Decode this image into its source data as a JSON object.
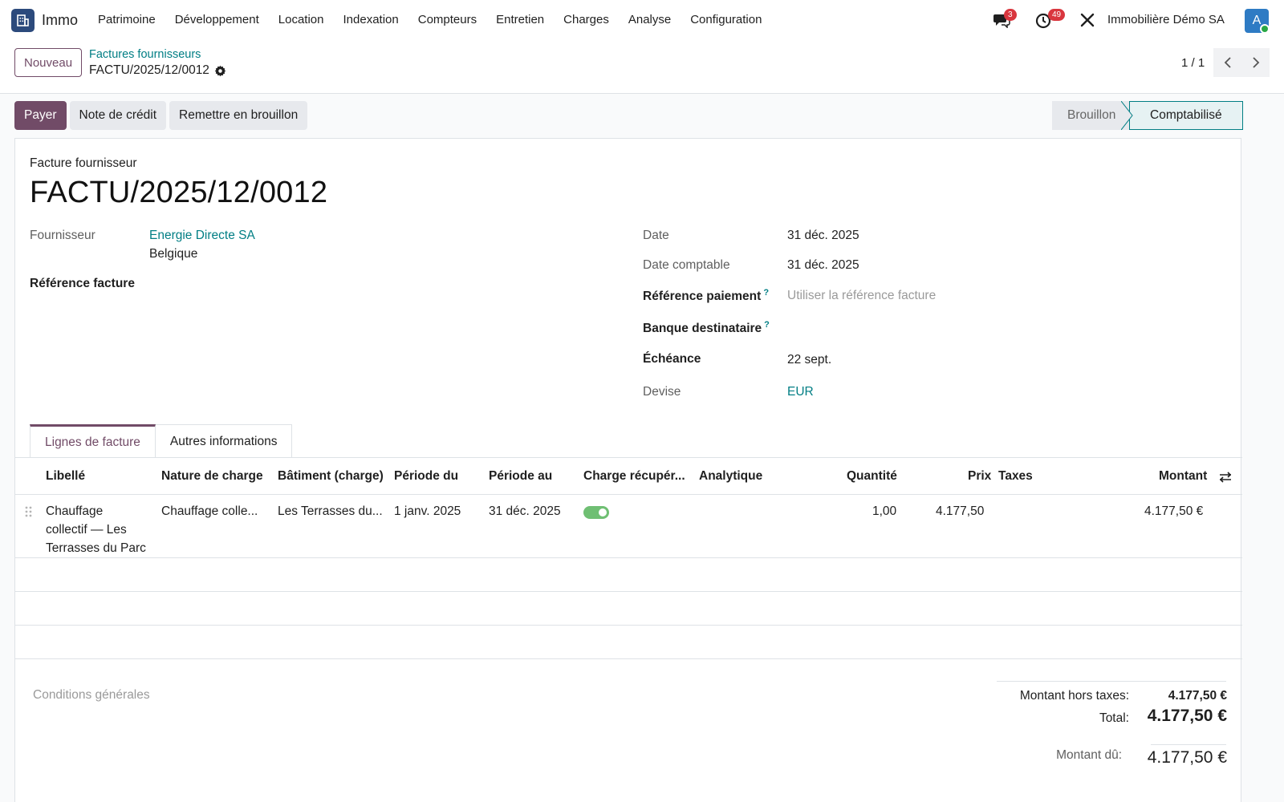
{
  "navbar": {
    "app_name": "Immo",
    "menu": [
      "Patrimoine",
      "Développement",
      "Location",
      "Indexation",
      "Compteurs",
      "Entretien",
      "Charges",
      "Analyse",
      "Configuration"
    ],
    "messages_count": "3",
    "activities_count": "49",
    "company": "Immobilière Démo SA",
    "avatar_letter": "A"
  },
  "control": {
    "new_label": "Nouveau",
    "breadcrumb_parent": "Factures fournisseurs",
    "breadcrumb_current": "FACTU/2025/12/0012",
    "pager": "1 / 1"
  },
  "actions": {
    "pay": "Payer",
    "credit_note": "Note de crédit",
    "reset_draft": "Remettre en brouillon"
  },
  "status": {
    "draft": "Brouillon",
    "posted": "Comptabilisé"
  },
  "form": {
    "doc_type": "Facture fournisseur",
    "title": "FACTU/2025/12/0012",
    "supplier_label": "Fournisseur",
    "supplier_name": "Energie Directe SA",
    "supplier_country": "Belgique",
    "ref_label": "Référence facture",
    "date_label": "Date",
    "date_value": "31 déc. 2025",
    "acc_date_label": "Date comptable",
    "acc_date_value": "31 déc. 2025",
    "pay_ref_label": "Référence paiement",
    "pay_ref_placeholder": "Utiliser la référence facture",
    "bank_label": "Banque destinataire",
    "due_label": "Échéance",
    "due_value": "22 sept.",
    "currency_label": "Devise",
    "currency_value": "EUR",
    "help_mark": "?"
  },
  "tabs": {
    "lines": "Lignes de facture",
    "other": "Autres informations"
  },
  "table": {
    "headers": {
      "label": "Libellé",
      "charge_type": "Nature de charge",
      "building": "Bâtiment (charge)",
      "from": "Période du",
      "to": "Période au",
      "recoverable": "Charge récupér...",
      "analytic": "Analytique",
      "qty": "Quantité",
      "price": "Prix",
      "taxes": "Taxes",
      "amount": "Montant"
    },
    "rows": [
      {
        "label_l1": "Chauffage",
        "label_l2": "collectif — Les",
        "label_l3": "Terrasses du Parc",
        "charge_type": "Chauffage colle...",
        "building": "Les Terrasses du...",
        "from": "1 janv. 2025",
        "to": "31 déc. 2025",
        "recoverable": true,
        "qty": "1,00",
        "price": "4.177,50",
        "amount": "4.177,50 €"
      }
    ]
  },
  "footer": {
    "terms_placeholder": "Conditions générales",
    "untaxed_label": "Montant hors taxes:",
    "untaxed_value": "4.177,50 €",
    "total_label": "Total:",
    "total_value": "4.177,50 €",
    "due_label": "Montant dû:",
    "due_value": "4.177,50 €"
  }
}
